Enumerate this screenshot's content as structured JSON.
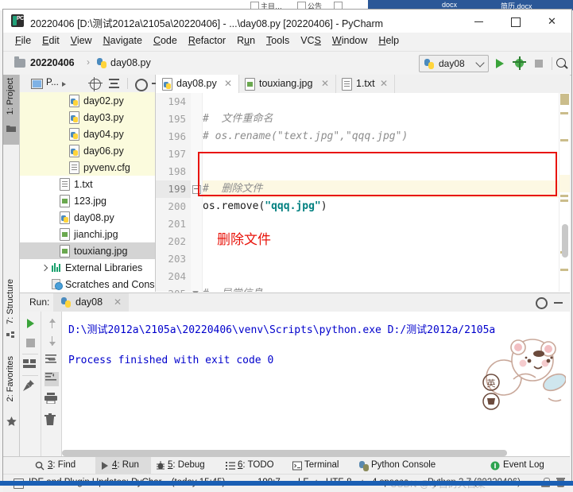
{
  "window": {
    "title": "20220406 [D:\\测试2012a\\2105a\\20220406] - ...\\day08.py [20220406] - PyCharm",
    "minimize_label": "−",
    "maximize_label": "□",
    "close_label": "✕"
  },
  "behind": {
    "items": [
      "docx",
      "简历.docx"
    ]
  },
  "menubar": [
    {
      "label": "File",
      "accel": "F"
    },
    {
      "label": "Edit",
      "accel": "E"
    },
    {
      "label": "View",
      "accel": "V"
    },
    {
      "label": "Navigate",
      "accel": "N"
    },
    {
      "label": "Code",
      "accel": "C"
    },
    {
      "label": "Refactor",
      "accel": "R"
    },
    {
      "label": "Run",
      "accel": "u"
    },
    {
      "label": "Tools",
      "accel": "T"
    },
    {
      "label": "VCS",
      "accel": "S"
    },
    {
      "label": "Window",
      "accel": "W"
    },
    {
      "label": "Help",
      "accel": "H"
    }
  ],
  "navbar": {
    "crumbs": [
      "20220406",
      "day08.py"
    ],
    "separator": "›",
    "run_config": "day08",
    "buttons": [
      "run-button",
      "debug-button",
      "stop-button",
      "search-everywhere-button"
    ]
  },
  "left_strip": [
    {
      "label": "1: Project",
      "selected": true
    },
    {
      "label": "7: Structure",
      "selected": false
    },
    {
      "label": "2: Favorites",
      "selected": false
    }
  ],
  "project_panel": {
    "title": "P...",
    "toolbar": [
      "select-opened-file-icon",
      "scroll-from-source-icon",
      "collapse-all-icon",
      "settings-gear-icon",
      "hide-icon"
    ],
    "tree": [
      {
        "label": "day02.py",
        "icon": "python-file-icon",
        "indent": 62,
        "venv": true
      },
      {
        "label": "day03.py",
        "icon": "python-file-icon",
        "indent": 62,
        "venv": true
      },
      {
        "label": "day04.py",
        "icon": "python-file-icon",
        "indent": 62,
        "venv": true
      },
      {
        "label": "day06.py",
        "icon": "python-file-icon",
        "indent": 62,
        "venv": true
      },
      {
        "label": "pyvenv.cfg",
        "icon": "text-file-icon",
        "indent": 62,
        "venv": true
      },
      {
        "label": "1.txt",
        "icon": "text-file-icon",
        "indent": 50,
        "venv": false
      },
      {
        "label": "123.jpg",
        "icon": "image-file-icon",
        "indent": 50,
        "venv": false
      },
      {
        "label": "day08.py",
        "icon": "python-file-icon",
        "indent": 50,
        "venv": false
      },
      {
        "label": "jianchi.jpg",
        "icon": "image-file-icon",
        "indent": 50,
        "venv": false
      },
      {
        "label": "touxiang.jpg",
        "icon": "image-file-icon",
        "indent": 50,
        "venv": false,
        "selected": true
      },
      {
        "label": "External Libraries",
        "icon": "library-icon",
        "indent": 28,
        "venv": false,
        "arrow": true
      },
      {
        "label": "Scratches and Consol",
        "icon": "scratches-icon",
        "indent": 38,
        "venv": false
      }
    ]
  },
  "editor": {
    "tabs": [
      {
        "label": "day08.py",
        "icon": "python-file-icon",
        "active": true
      },
      {
        "label": "touxiang.jpg",
        "icon": "image-file-icon",
        "active": false
      },
      {
        "label": "1.txt",
        "icon": "text-file-icon",
        "active": false
      }
    ],
    "first_line_number": 194,
    "lines": [
      {
        "num": "194",
        "segments": []
      },
      {
        "num": "195",
        "segments": [
          {
            "t": "#  文件重命名",
            "c": "cm"
          }
        ]
      },
      {
        "num": "196",
        "segments": [
          {
            "t": "# os.rename(\"text.jpg\",\"qqq.jpg\")",
            "c": "cm"
          }
        ]
      },
      {
        "num": "197",
        "segments": []
      },
      {
        "num": "198",
        "segments": []
      },
      {
        "num": "199",
        "segments": [
          {
            "t": "#  删除文件",
            "c": "cm"
          }
        ],
        "highlight": true,
        "fold": "minus"
      },
      {
        "num": "200",
        "segments": [
          {
            "t": "os.remove",
            "c": "kwplain"
          },
          {
            "t": "(",
            "c": "paren"
          },
          {
            "t": "\"qqq.jpg\"",
            "c": "str"
          },
          {
            "t": ")",
            "c": "paren"
          }
        ]
      },
      {
        "num": "201",
        "segments": []
      },
      {
        "num": "202",
        "segments": []
      },
      {
        "num": "203",
        "segments": []
      },
      {
        "num": "204",
        "segments": []
      },
      {
        "num": "205",
        "segments": [
          {
            "t": "#  异常信息",
            "c": "cm"
          }
        ],
        "fold": "down"
      }
    ],
    "annotation": "删除文件",
    "annotation_color": "#e8140b"
  },
  "run_panel": {
    "label": "Run:",
    "tab_label": "day08",
    "tab_close": "✕",
    "toolbar_left": [
      "rerun-button",
      "stop-button",
      "restore-layout-button",
      "pin-tab-button"
    ],
    "toolbar_right": [
      "up-the-stack-trace-button",
      "down-the-stack-trace-button",
      "soft-wrap-button",
      "scroll-to-end-button",
      "print-button",
      "clear-all-button"
    ],
    "console_lines": [
      "D:\\测试2012a\\2105a\\20220406\\venv\\Scripts\\python.exe D:/测试2012a/2105a",
      "",
      "Process finished with exit code 0"
    ],
    "console_color": "#0000cc"
  },
  "bottom_bar": [
    {
      "label": "3: Find",
      "accel": "3",
      "icon": "search-icon",
      "selected": false
    },
    {
      "label": "4: Run",
      "accel": "4",
      "icon": "run-icon",
      "selected": true
    },
    {
      "label": "5: Debug",
      "accel": "5",
      "icon": "bug-icon",
      "selected": false
    },
    {
      "label": "6: TODO",
      "accel": "6",
      "icon": "list-icon",
      "selected": false
    },
    {
      "label": "Terminal",
      "accel": "",
      "icon": "terminal-icon",
      "selected": false
    },
    {
      "label": "Python Console",
      "accel": "",
      "icon": "python-icon",
      "selected": false
    },
    {
      "label": "Event Log",
      "accel": "",
      "icon": "event-log-icon",
      "selected": false
    }
  ],
  "status_bar": {
    "notification": "IDE and Plugin Updates: PyChar... (today 15:45)",
    "caret_position": "199:7",
    "line_separator": "LF",
    "encoding": "UTF-8",
    "indent": "4 spaces",
    "interpreter": "Python 3.7 (20220406)",
    "watermark": "CSDN @小白的大白菜",
    "icons": [
      "lock-icon",
      "trash-icon"
    ]
  }
}
